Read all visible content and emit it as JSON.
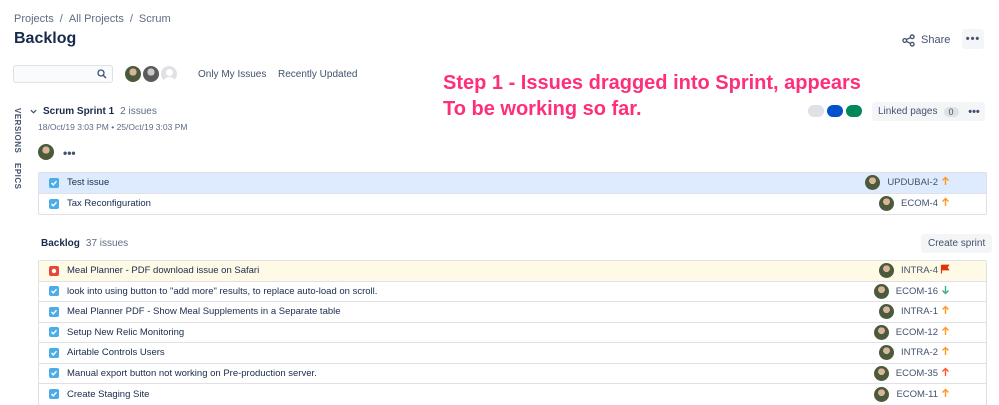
{
  "breadcrumb": [
    "Projects",
    "All Projects",
    "Scrum"
  ],
  "page_title": "Backlog",
  "header_actions": {
    "share_label": "Share",
    "more_label": "•••"
  },
  "filters": {
    "search_placeholder": "",
    "only_my_issues": "Only My Issues",
    "recently_updated": "Recently Updated"
  },
  "annotation": "Step 1 - Issues dragged into Sprint, appears\nTo be working so far.",
  "side_labels": {
    "versions": "VERSIONS",
    "epics": "EPICS"
  },
  "sprint": {
    "name": "Scrum Sprint 1",
    "count": "2 issues",
    "dates": "18/Oct/19 3:03 PM • 25/Oct/19 3:03 PM",
    "linked_pages_label": "Linked pages",
    "linked_pages_count": "0",
    "more_label": "•••",
    "status_colors": [
      "#dfe1e6",
      "#0052cc",
      "#00875a"
    ],
    "issues": [
      {
        "summary": "Test issue",
        "key": "UPDUBAI-2",
        "type": "task",
        "priority": "medium"
      },
      {
        "summary": "Tax Reconfiguration",
        "key": "ECOM-4",
        "type": "task",
        "priority": "medium"
      }
    ]
  },
  "backlog": {
    "name": "Backlog",
    "count": "37 issues",
    "create_sprint_label": "Create sprint",
    "issues": [
      {
        "summary": "Meal Planner - PDF download issue on Safari",
        "key": "INTRA-4",
        "type": "bug",
        "priority": "highest"
      },
      {
        "summary": "look into using button to \"add more\" results, to replace auto-load on scroll.",
        "key": "ECOM-16",
        "type": "task",
        "priority": "low"
      },
      {
        "summary": "Meal Planner PDF - Show Meal Supplements in a Separate table",
        "key": "INTRA-1",
        "type": "task",
        "priority": "medium"
      },
      {
        "summary": "Setup New Relic Monitoring",
        "key": "ECOM-12",
        "type": "task",
        "priority": "medium"
      },
      {
        "summary": "Airtable Controls Users",
        "key": "INTRA-2",
        "type": "task",
        "priority": "medium"
      },
      {
        "summary": "Manual export button not working on Pre-production server.",
        "key": "ECOM-35",
        "type": "task",
        "priority": "high"
      },
      {
        "summary": "Create Staging Site",
        "key": "ECOM-11",
        "type": "task",
        "priority": "medium"
      }
    ]
  }
}
